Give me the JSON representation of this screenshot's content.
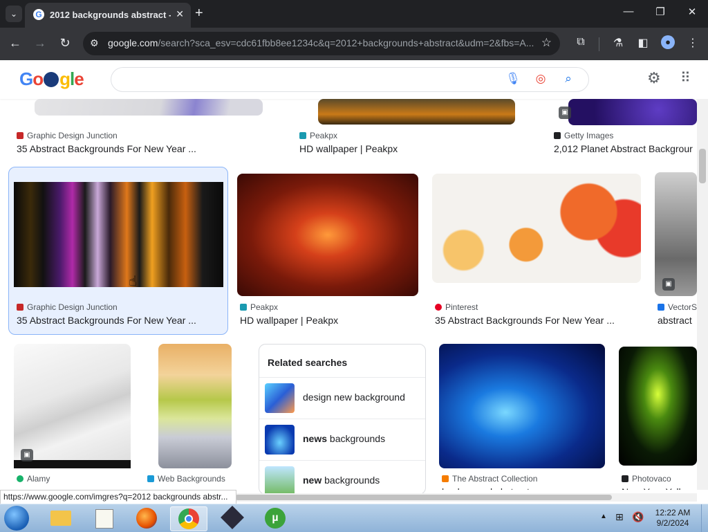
{
  "browser": {
    "tab_title": "2012 backgrounds abstract - G",
    "url_host": "google.com",
    "url_path": "/search?sca_esv=cdc61fbb8ee1234c&q=2012+backgrounds+abstract&udm=2&fbs=A..."
  },
  "google": {
    "search_value": ""
  },
  "results": {
    "row1": [
      {
        "source": "Graphic Design Junction",
        "title": "35 Abstract Backgrounds For New Year ..."
      },
      {
        "source": "Peakpx",
        "title": "HD wallpaper | Peakpx"
      },
      {
        "source": "Getty Images",
        "title": "2,012 Planet Abstract Backgrour"
      }
    ],
    "row2": [
      {
        "source": "Graphic Design Junction",
        "title": "35 Abstract Backgrounds For New Year ..."
      },
      {
        "source": "Peakpx",
        "title": "HD wallpaper | Peakpx"
      },
      {
        "source": "Pinterest",
        "title": "35 Abstract Backgrounds For New Year ..."
      },
      {
        "source": "VectorS",
        "title": "abstract"
      }
    ],
    "row3": [
      {
        "source": "Alamy",
        "title": ""
      },
      {
        "source": "Web Backgrounds",
        "title": ""
      },
      {
        "source": "The Abstract Collection",
        "title": "background abstract"
      },
      {
        "source": "Photovaco",
        "title": "New Year Yellow"
      }
    ]
  },
  "related": {
    "heading": "Related searches",
    "items": [
      {
        "bold": "",
        "rest": "design new background"
      },
      {
        "bold": "news",
        "rest": " backgrounds"
      },
      {
        "bold": "new",
        "rest": " backgrounds"
      }
    ]
  },
  "status_url": "https://www.google.com/imgres?q=2012 backgrounds abstr...",
  "clock": {
    "time": "12:22 AM",
    "date": "9/2/2024"
  }
}
